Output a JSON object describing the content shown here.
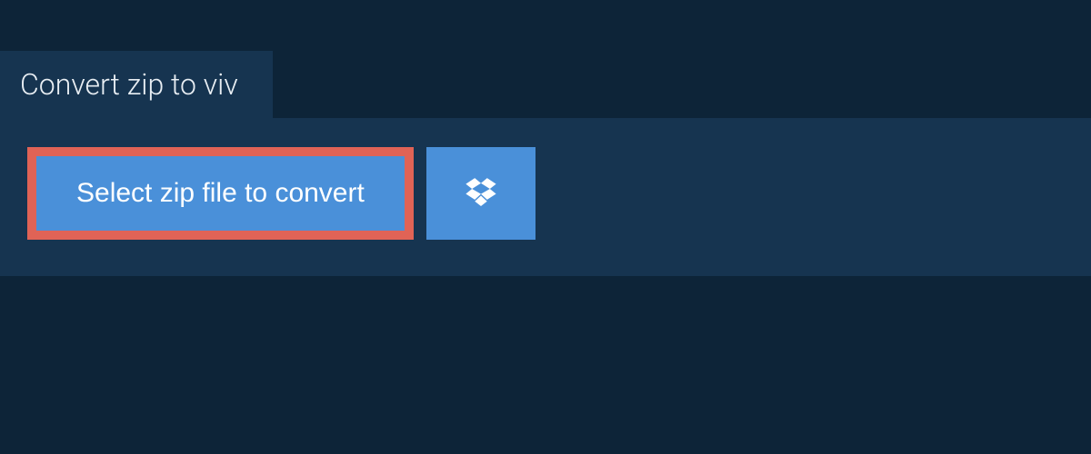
{
  "header": {
    "title": "Convert zip to viv"
  },
  "actions": {
    "select_file_label": "Select zip file to convert"
  },
  "colors": {
    "background": "#0d2438",
    "panel": "#163450",
    "button": "#4a90d9",
    "highlight_border": "#e06356",
    "text_light": "#ffffff"
  }
}
